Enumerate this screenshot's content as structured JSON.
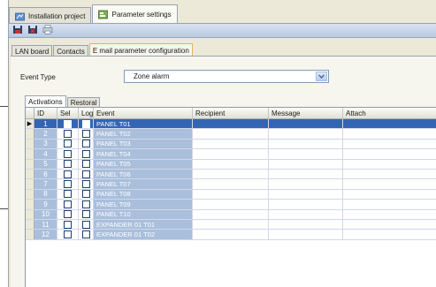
{
  "document_tabs": [
    {
      "label": "Installation project",
      "icon": "project-icon",
      "active": false
    },
    {
      "label": "Parameter settings",
      "icon": "settings-icon",
      "active": true
    }
  ],
  "toolbar": {
    "buttons": [
      {
        "icon": "save-icon"
      },
      {
        "icon": "delete-icon"
      },
      {
        "icon": "print-icon"
      }
    ]
  },
  "sub_tabs": [
    {
      "label": "LAN board",
      "active": false
    },
    {
      "label": "Contacts",
      "active": false
    },
    {
      "label": "E mail parameter configuration",
      "active": true
    }
  ],
  "event_type": {
    "label": "Event Type",
    "value": "Zone alarm"
  },
  "inner_tabs": [
    {
      "label": "Activations",
      "active": true
    },
    {
      "label": "Restoral",
      "active": false
    }
  ],
  "grid": {
    "columns": [
      "ID",
      "Sel",
      "Log",
      "Event",
      "Recipient",
      "Message",
      "Attach"
    ],
    "selected_row": 0,
    "rows": [
      {
        "id": "1",
        "event": "PANEL T01"
      },
      {
        "id": "2",
        "event": "PANEL T02"
      },
      {
        "id": "3",
        "event": "PANEL T03"
      },
      {
        "id": "4",
        "event": "PANEL T04"
      },
      {
        "id": "5",
        "event": "PANEL T05"
      },
      {
        "id": "6",
        "event": "PANEL T06"
      },
      {
        "id": "7",
        "event": "PANEL T07"
      },
      {
        "id": "8",
        "event": "PANEL T08"
      },
      {
        "id": "9",
        "event": "PANEL T09"
      },
      {
        "id": "10",
        "event": "PANEL T10"
      },
      {
        "id": "11",
        "event": "EXPANDER 01 T01"
      },
      {
        "id": "12",
        "event": "EXPANDER 01 T02"
      }
    ]
  },
  "colors": {
    "selection": "#3464b4",
    "id_event_column": "#a9bfdc",
    "active_tab_border": "#e3b45c"
  }
}
